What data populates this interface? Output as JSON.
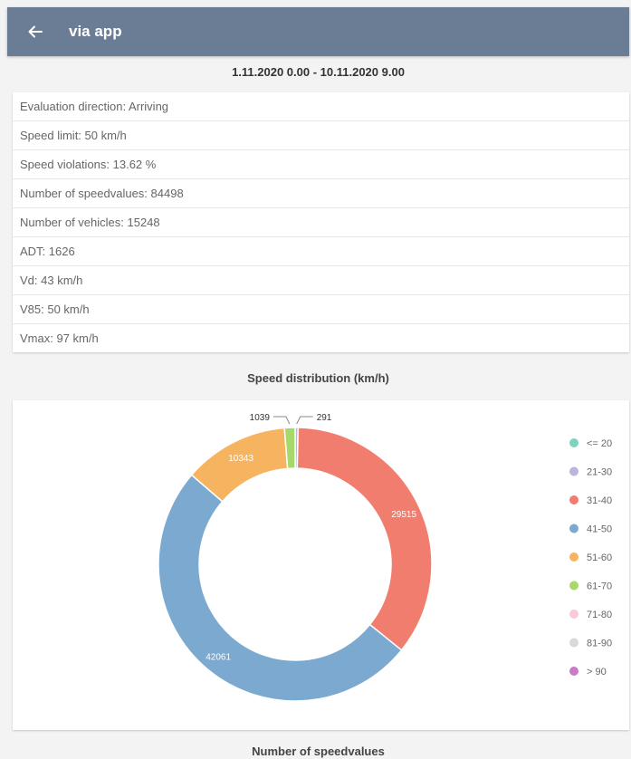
{
  "appbar": {
    "title": "via app",
    "back_icon": "arrow-left-icon"
  },
  "period": "1.11.2020 0.00 - 10.11.2020 9.00",
  "info_rows": [
    "Evaluation direction: Arriving",
    "Speed limit: 50 km/h",
    "Speed violations: 13.62 %",
    "Number of speedvalues: 84498",
    "Number of vehicles: 15248",
    "ADT: 1626",
    "Vd: 43 km/h",
    "V85: 50 km/h",
    "Vmax: 97 km/h"
  ],
  "speed_distribution_title": "Speed distribution (km/h)",
  "number_of_speedvalues_title": "Number of speedvalues",
  "chart_data": {
    "type": "pie",
    "donut": true,
    "title": "Speed distribution (km/h)",
    "legend_position": "right",
    "categories": [
      "<= 20",
      "21-30",
      "31-40",
      "41-50",
      "51-60",
      "61-70",
      "71-80",
      "81-90",
      "> 90"
    ],
    "values": [
      0,
      291,
      29515,
      42061,
      10343,
      1039,
      0,
      0,
      0
    ],
    "labels": [
      "",
      "291",
      "29515",
      "42061",
      "10343",
      "1039",
      "",
      "",
      ""
    ],
    "colors": [
      "#7fd1c0",
      "#b9b5dc",
      "#f17d6f",
      "#7ba9cf",
      "#f6b461",
      "#a6d96a",
      "#f9c9dc",
      "#d9d9d9",
      "#c77bc8"
    ]
  }
}
